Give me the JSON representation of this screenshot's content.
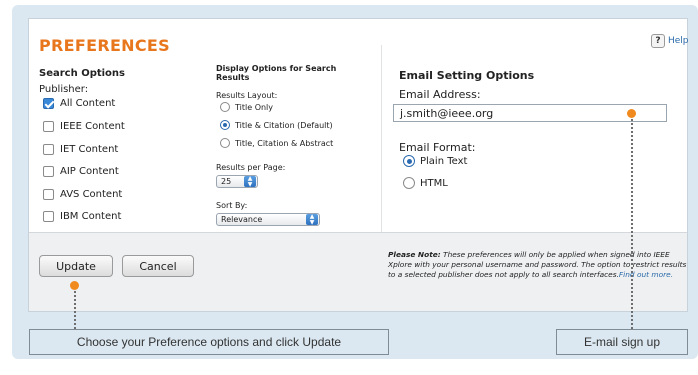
{
  "title": "PREFERENCES",
  "help": {
    "icon_char": "?",
    "label": "Help"
  },
  "search_options": {
    "heading": "Search Options",
    "publisher_label": "Publisher:",
    "publishers": [
      {
        "label": "All Content",
        "checked": true
      },
      {
        "label": "IEEE Content",
        "checked": false
      },
      {
        "label": "IET Content",
        "checked": false
      },
      {
        "label": "AIP Content",
        "checked": false
      },
      {
        "label": "AVS Content",
        "checked": false
      },
      {
        "label": "IBM Content",
        "checked": false
      }
    ]
  },
  "display_options": {
    "heading_line1": "Display Options for Search",
    "heading_line2": "Results",
    "layout_label": "Results Layout:",
    "layouts": [
      {
        "label": "Title Only",
        "selected": false
      },
      {
        "label": "Title & Citation (Default)",
        "selected": true
      },
      {
        "label": "Title, Citation & Abstract",
        "selected": false
      }
    ],
    "per_page_label": "Results per Page:",
    "per_page_value": "25",
    "sort_label": "Sort By:",
    "sort_value": "Relevance"
  },
  "email_options": {
    "heading": "Email Setting Options",
    "address_label": "Email Address:",
    "address_value": "j.smith@ieee.org",
    "format_label": "Email Format:",
    "formats": [
      {
        "label": "Plain Text",
        "selected": true
      },
      {
        "label": "HTML",
        "selected": false
      }
    ]
  },
  "buttons": {
    "update": "Update",
    "cancel": "Cancel"
  },
  "note": {
    "lead": "Please Note:",
    "text": " These preferences will only be applied when signed into IEEE Xplore with your personal username and password. The option to restrict results to a selected publisher does not apply to all search interfaces.",
    "link": "Find out more."
  },
  "callouts": {
    "left": "Choose your Preference options and click Update",
    "right": "E-mail sign up"
  },
  "colors": {
    "accent": "#e8761c",
    "link": "#2a6aa8",
    "marker": "#f08a1e",
    "callout_bg": "#dbe8f1"
  }
}
